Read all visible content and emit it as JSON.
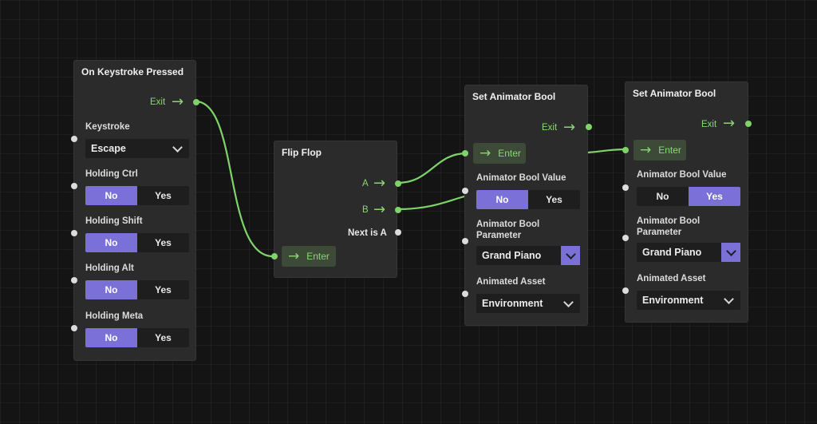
{
  "nodes": {
    "keystroke": {
      "title": "On Keystroke Pressed",
      "exit_label": "Exit",
      "keystroke_label": "Keystroke",
      "keystroke_value": "Escape",
      "ctrl_label": "Holding Ctrl",
      "shift_label": "Holding Shift",
      "alt_label": "Holding Alt",
      "meta_label": "Holding Meta",
      "no": "No",
      "yes": "Yes",
      "ctrl_value": "No",
      "shift_value": "No",
      "alt_value": "No",
      "meta_value": "No"
    },
    "flipflop": {
      "title": "Flip Flop",
      "a_label": "A",
      "b_label": "B",
      "next_label": "Next is A",
      "enter_label": "Enter"
    },
    "animator1": {
      "title": "Set Animator Bool",
      "exit_label": "Exit",
      "enter_label": "Enter",
      "bool_value_label": "Animator Bool Value",
      "no": "No",
      "yes": "Yes",
      "bool_value": "No",
      "param_label_1": "Animator Bool",
      "param_label_2": "Parameter",
      "param_value": "Grand Piano",
      "asset_label": "Animated Asset",
      "asset_value": "Environment"
    },
    "animator2": {
      "title": "Set Animator Bool",
      "exit_label": "Exit",
      "enter_label": "Enter",
      "bool_value_label": "Animator Bool Value",
      "no": "No",
      "yes": "Yes",
      "bool_value": "Yes",
      "param_label_1": "Animator Bool",
      "param_label_2": "Parameter",
      "param_value": "Grand Piano",
      "asset_label": "Animated Asset",
      "asset_value": "Environment"
    }
  },
  "colors": {
    "background": "#141414",
    "node": "#2b2b2b",
    "accent": "#7b70d8",
    "flow": "#7fd36a",
    "enter_bg": "#3c4a37"
  }
}
